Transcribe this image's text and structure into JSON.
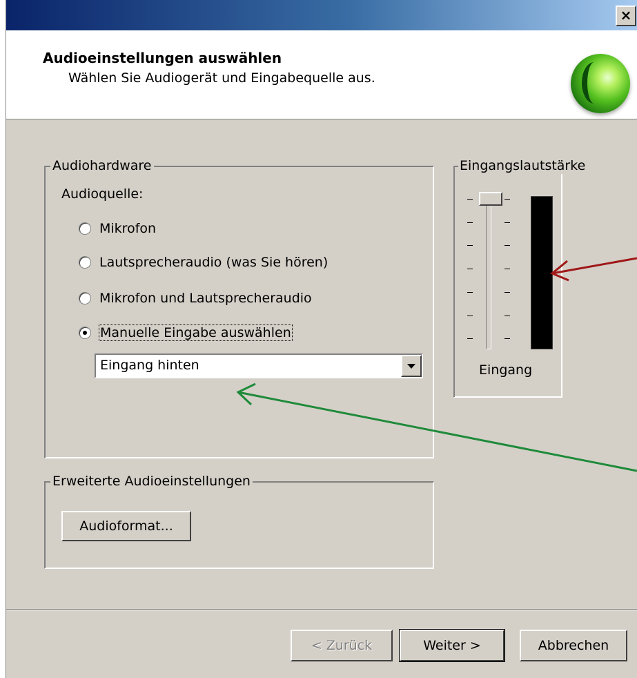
{
  "window": {
    "close_glyph": "×"
  },
  "header": {
    "title": "Audioeinstellungen auswählen",
    "subtitle": "Wählen Sie Audiogerät und Eingabequelle aus.",
    "logo_icon": "green-orb-logo"
  },
  "audio_hardware": {
    "legend": "Audiohardware",
    "source_label": "Audioquelle:",
    "options": [
      {
        "label": "Mikrofon",
        "checked": false
      },
      {
        "label": "Lautsprecheraudio (was Sie hören)",
        "checked": false
      },
      {
        "label": "Mikrofon und Lautsprecheraudio",
        "checked": false
      },
      {
        "label": "Manuelle Eingabe auswählen",
        "checked": true
      }
    ],
    "input_select": {
      "value": "Eingang hinten"
    }
  },
  "input_volume": {
    "legend": "Eingangslautstärke",
    "slider_level": 1.0,
    "meter_level": 0,
    "caption": "Eingang"
  },
  "advanced": {
    "legend": "Erweiterte Audioeinstellungen",
    "format_button": "Audioformat..."
  },
  "footer": {
    "back_button": "< Zurück",
    "next_button": "Weiter >",
    "cancel_button": "Abbrechen"
  },
  "colors": {
    "red_arrow": "#a01818",
    "green_arrow": "#1f8a3a"
  }
}
